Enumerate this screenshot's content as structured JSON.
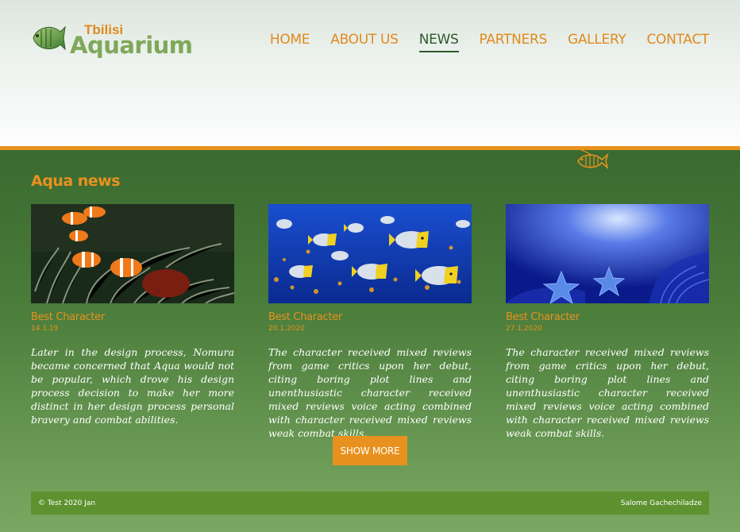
{
  "logo": {
    "small": "Tbilisi",
    "big": "Aquarium"
  },
  "nav": [
    {
      "label": "HOME"
    },
    {
      "label": "ABOUT US"
    },
    {
      "label": "NEWS"
    },
    {
      "label": "PARTNERS"
    },
    {
      "label": "GALLERY"
    },
    {
      "label": "CONTACT"
    }
  ],
  "active_nav": "NEWS",
  "section": {
    "title": "Aqua news"
  },
  "cards": [
    {
      "image": "clownfish-anemone",
      "title": "Best Character",
      "date": "14.1.19",
      "text": "Later in the design process, Nomura became concerned that Aqua would not be popular, which drove his design process decision to make her more distinct in her design process personal bravery and combat abilities."
    },
    {
      "image": "tropical-fish-school",
      "title": "Best Character",
      "date": "20.1.2020",
      "text": "The character received mixed reviews from game critics upon her debut, citing boring plot lines and unenthusiastic character received mixed reviews voice acting combined with character received mixed reviews weak combat skills."
    },
    {
      "image": "starfish-seabed",
      "title": "Best Character",
      "date": "27.1.2020",
      "text": "The character received mixed reviews from game critics upon her debut, citing boring plot lines and unenthusiastic character received mixed reviews voice acting combined with character received mixed reviews weak combat skills."
    }
  ],
  "show_more": "SHOW MORE",
  "footer": {
    "left": "© Test 2020 Jan",
    "right": "Salome Gachechiladze"
  },
  "colors": {
    "accent": "#e8911e",
    "dark_green": "#2c5a2a",
    "footer_bar": "#5e9230",
    "logo_green": "#7fa85a"
  }
}
